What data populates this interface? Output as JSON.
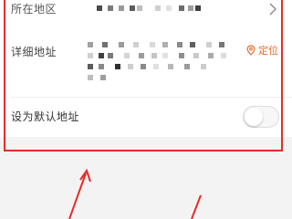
{
  "form": {
    "region": {
      "label": "所在地区"
    },
    "detail_address": {
      "label": "详细地址",
      "locate_label": "定位"
    },
    "set_default": {
      "label": "设为默认地址",
      "enabled": false
    }
  },
  "annotation": {
    "color": "#e82a2a"
  },
  "colors": {
    "accent": "#e66b2e",
    "highlight": "#e82a2a"
  },
  "icons": {
    "region_chevron": "chevron-right-icon",
    "locate": "location-pin-icon"
  }
}
